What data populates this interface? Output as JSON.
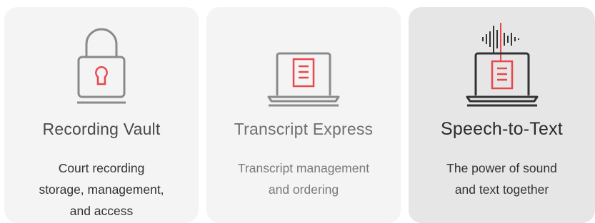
{
  "cards": [
    {
      "title": "Recording Vault",
      "description_lines": [
        "Court recording",
        "storage, management,",
        "and access"
      ],
      "icon": "lock-icon"
    },
    {
      "title": "Transcript Express",
      "description_lines": [
        "Transcript management",
        "and ordering"
      ],
      "icon": "laptop-document-icon"
    },
    {
      "title": "Speech-to-Text",
      "description_lines": [
        "The power of sound",
        "and text together"
      ],
      "icon": "laptop-soundwave-icon"
    }
  ],
  "colors": {
    "icon_gray": "#8a8a8a",
    "icon_dark": "#333333",
    "accent_red": "#e8474c",
    "card_bg": "#f4f4f4",
    "card_bg_active": "#e6e6e6"
  }
}
